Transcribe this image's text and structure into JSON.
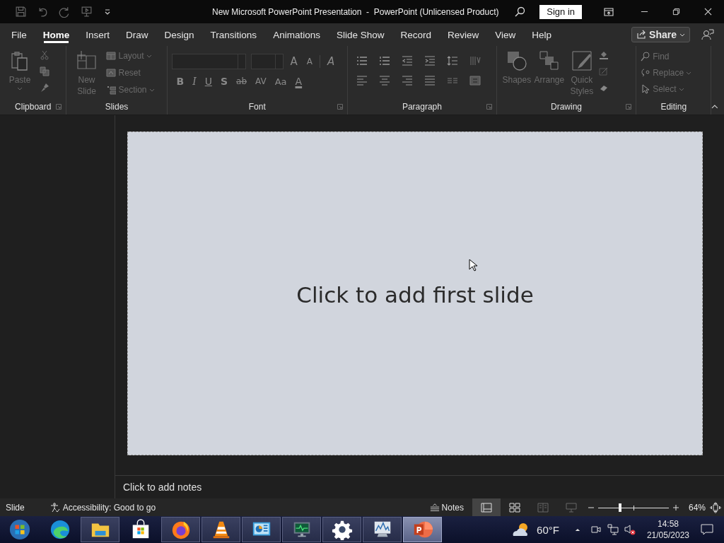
{
  "title_bar": {
    "title": "New Microsoft PowerPoint Presentation  -  PowerPoint (Unlicensed Product)",
    "sign_in": "Sign in"
  },
  "tabs": [
    {
      "label": "File",
      "selected": false
    },
    {
      "label": "Home",
      "selected": true
    },
    {
      "label": "Insert",
      "selected": false
    },
    {
      "label": "Draw",
      "selected": false
    },
    {
      "label": "Design",
      "selected": false
    },
    {
      "label": "Transitions",
      "selected": false
    },
    {
      "label": "Animations",
      "selected": false
    },
    {
      "label": "Slide Show",
      "selected": false
    },
    {
      "label": "Record",
      "selected": false
    },
    {
      "label": "Review",
      "selected": false
    },
    {
      "label": "View",
      "selected": false
    },
    {
      "label": "Help",
      "selected": false
    }
  ],
  "share": "Share",
  "ribbon": {
    "disabled": true,
    "clipboard": {
      "label": "Clipboard",
      "paste": "Paste"
    },
    "slides": {
      "label": "Slides",
      "new_slide": "New Slide",
      "layout": "Layout",
      "reset": "Reset",
      "section": "Section"
    },
    "font": {
      "label": "Font",
      "grow": "A",
      "shrink": "A",
      "clear": "A",
      "format_buttons": [
        "B",
        "I",
        "U",
        "S",
        "ab",
        "AV",
        "Aa",
        "A"
      ]
    },
    "paragraph": {
      "label": "Paragraph"
    },
    "drawing": {
      "label": "Drawing",
      "shapes": "Shapes",
      "arrange": "Arrange",
      "quick_styles": "Quick Styles"
    },
    "editing": {
      "label": "Editing",
      "find": "Find",
      "replace": "Replace",
      "select": "Select"
    }
  },
  "slide": {
    "placeholder": "Click to add first slide"
  },
  "notes": {
    "placeholder": "Click to add notes"
  },
  "status_bar": {
    "slide": "Slide",
    "accessibility": "Accessibility: Good to go",
    "notes": "Notes",
    "views": [
      {
        "kind": "normal",
        "selected": true
      },
      {
        "kind": "sorter",
        "selected": false
      },
      {
        "kind": "reading",
        "selected": false
      },
      {
        "kind": "show",
        "selected": false
      }
    ],
    "zoom": {
      "level": 0.31,
      "reading": "64%"
    }
  },
  "taskbar": {
    "apps": [
      {
        "kind": "start",
        "running": false,
        "selected": false
      },
      {
        "kind": "edge",
        "running": false,
        "selected": false
      },
      {
        "kind": "folder",
        "running": true,
        "selected": false
      },
      {
        "kind": "store",
        "running": false,
        "selected": false
      },
      {
        "kind": "firefox",
        "running": true,
        "selected": false
      },
      {
        "kind": "cone",
        "running": true,
        "selected": false
      },
      {
        "kind": "panel",
        "running": true,
        "selected": false
      },
      {
        "kind": "monitor",
        "running": true,
        "selected": false
      },
      {
        "kind": "gear",
        "running": true,
        "selected": false
      },
      {
        "kind": "chart",
        "running": true,
        "selected": false
      },
      {
        "kind": "powerpoint",
        "running": true,
        "selected": true
      }
    ],
    "weather": "60°F",
    "time": "14:58",
    "date": "21/05/2023"
  }
}
